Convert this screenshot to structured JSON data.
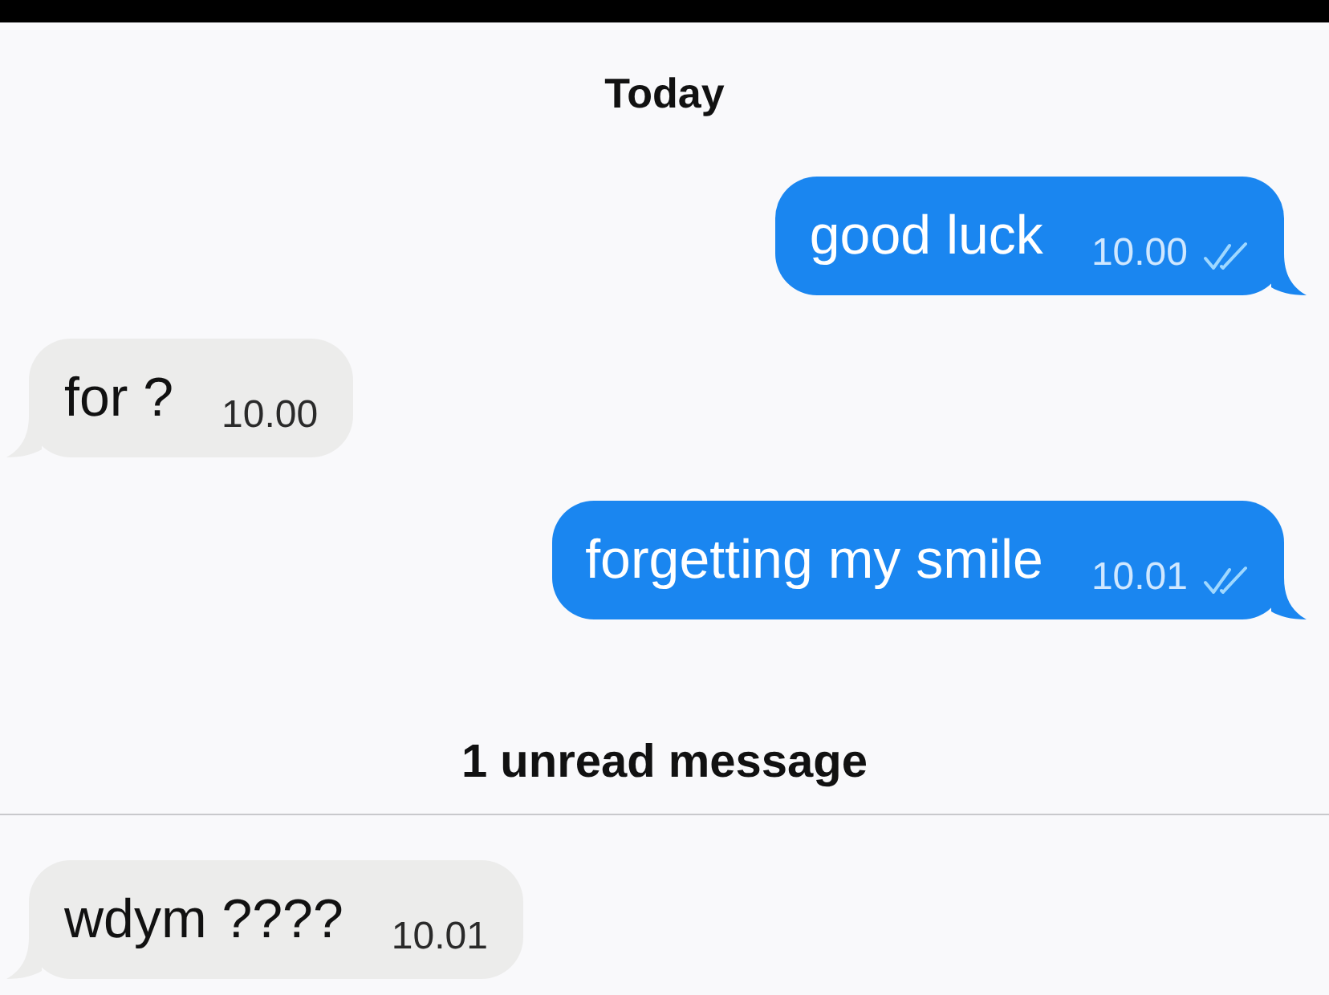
{
  "items": [
    {
      "kind": "date_divider",
      "text": "Today"
    },
    {
      "kind": "outgoing",
      "text": "good luck",
      "time": "10.00",
      "read": true
    },
    {
      "kind": "incoming",
      "text": "for ?",
      "time": "10.00"
    },
    {
      "kind": "outgoing",
      "text": "forgetting my smile",
      "time": "10.01",
      "read": true
    },
    {
      "kind": "unread_divider",
      "text": "1 unread message"
    },
    {
      "kind": "incoming",
      "text": "wdym ????",
      "time": "10.01"
    }
  ]
}
